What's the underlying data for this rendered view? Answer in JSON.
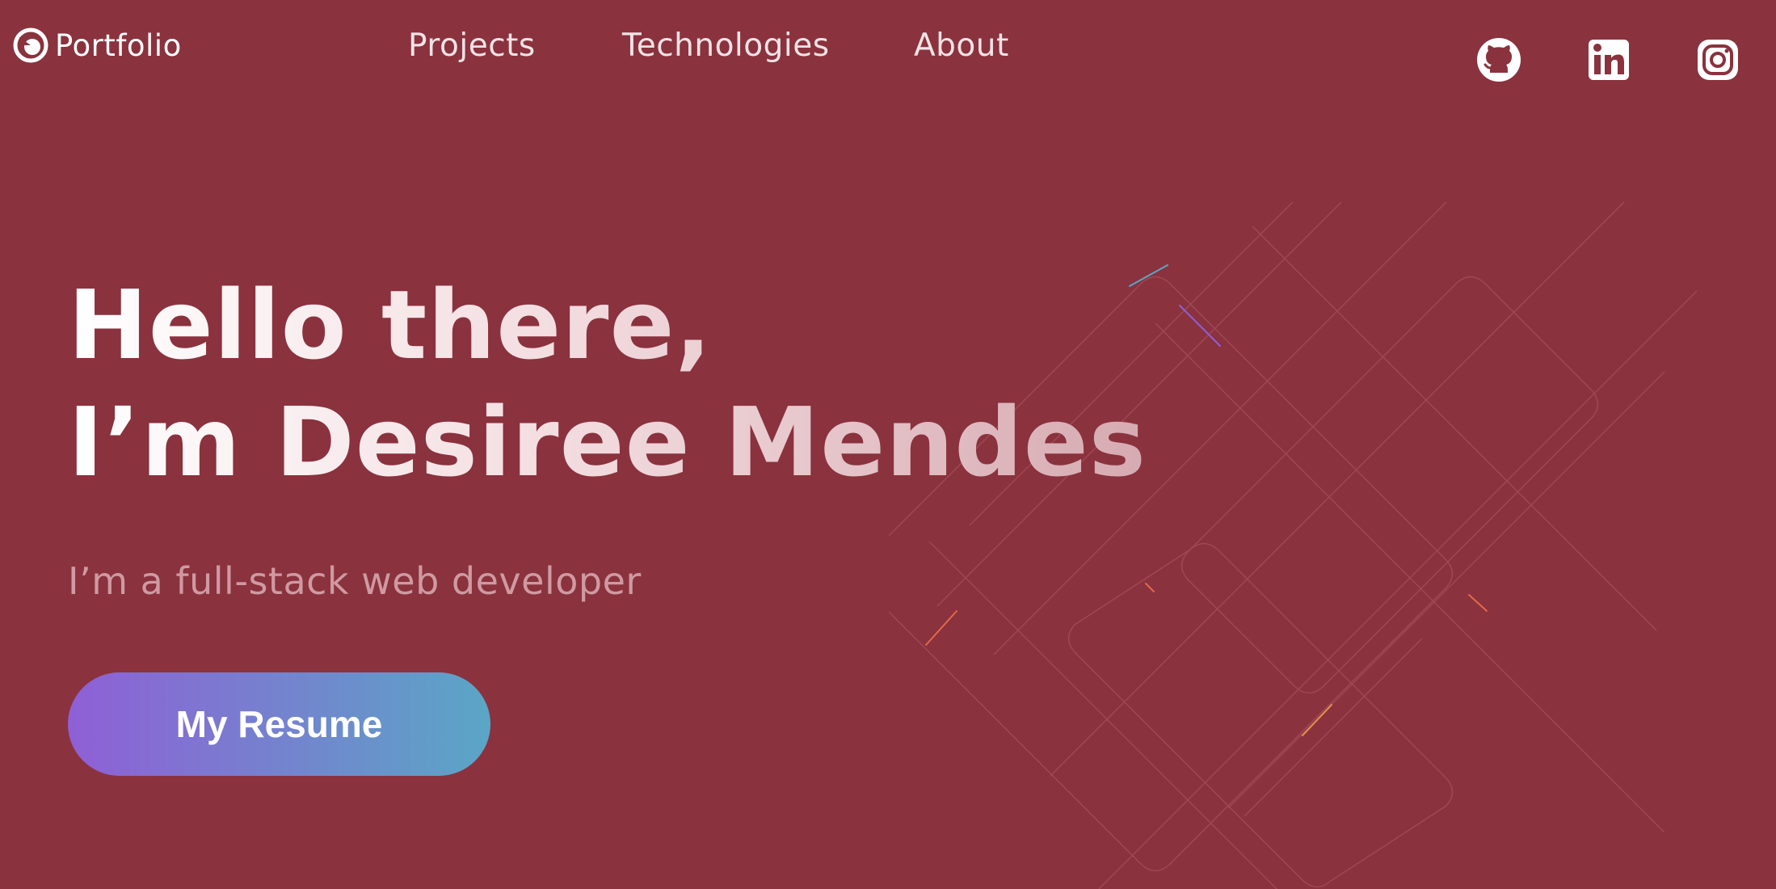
{
  "header": {
    "logo_text": "Portfolio",
    "nav": [
      {
        "label": "Projects"
      },
      {
        "label": "Technologies"
      },
      {
        "label": "About"
      }
    ],
    "social": [
      {
        "icon": "github-icon"
      },
      {
        "icon": "linkedin-icon"
      },
      {
        "icon": "instagram-icon"
      }
    ]
  },
  "hero": {
    "title_line1": "Hello there,",
    "title_line2": "I’m Desiree Mendes",
    "subtitle": "I’m a full-stack web developer",
    "button_label": "My Resume"
  },
  "colors": {
    "background": "#8a323e",
    "subtitle": "#cf9aa2",
    "button_gradient_start": "#8f5fd6",
    "button_gradient_end": "#5aa6c6"
  }
}
